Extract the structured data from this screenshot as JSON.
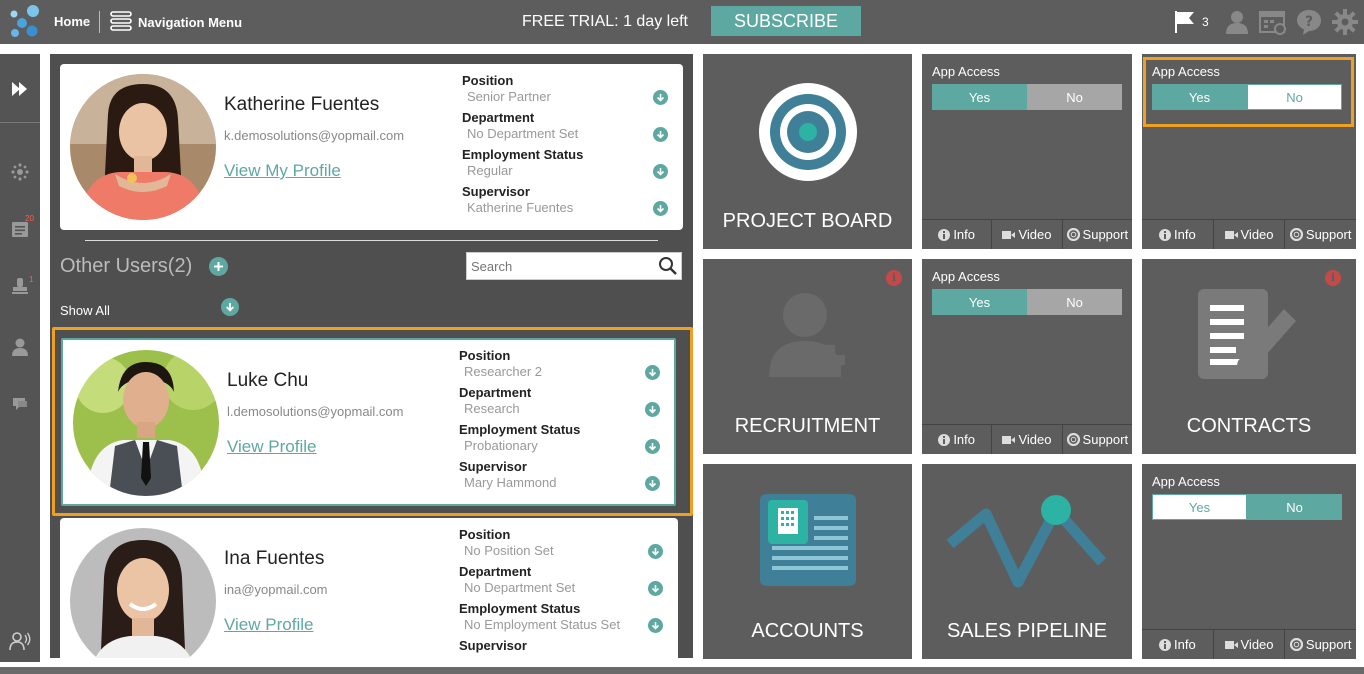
{
  "header": {
    "home": "Home",
    "nav_menu": "Navigation Menu",
    "trial_text": "FREE TRIAL: 1 day left",
    "subscribe": "SUBSCRIBE",
    "flag_count": "3",
    "icons": [
      "flag-icon",
      "user-icon",
      "calendar-settings-icon",
      "help-icon",
      "gear-icon"
    ]
  },
  "rail": {
    "badges": {
      "tasks": "20",
      "approvals": "1"
    },
    "icons": [
      "expand-icon",
      "dashboard-icon",
      "tasks-icon",
      "stamp-icon",
      "user-icon",
      "chat-icon",
      "users-voice-icon"
    ]
  },
  "me": {
    "name": "Katherine Fuentes",
    "email": "k.demosolutions@yopmail.com",
    "link": "View My Profile",
    "fields": [
      {
        "label": "Position",
        "value": "Senior Partner"
      },
      {
        "label": "Department",
        "value": "No Department Set"
      },
      {
        "label": "Employment Status",
        "value": "Regular"
      },
      {
        "label": "Supervisor",
        "value": "Katherine Fuentes"
      }
    ]
  },
  "others": {
    "title": "Other Users(2)",
    "search_placeholder": "Search",
    "show_all": "Show All",
    "users": [
      {
        "name": "Luke Chu",
        "email": "l.demosolutions@yopmail.com",
        "link": "View Profile",
        "fields": [
          {
            "label": "Position",
            "value": "Researcher 2"
          },
          {
            "label": "Department",
            "value": "Research"
          },
          {
            "label": "Employment Status",
            "value": "Probationary"
          },
          {
            "label": "Supervisor",
            "value": "Mary Hammond"
          }
        ]
      },
      {
        "name": "Ina Fuentes",
        "email": "ina@yopmail.com",
        "link": "View Profile",
        "fields": [
          {
            "label": "Position",
            "value": "No Position Set"
          },
          {
            "label": "Department",
            "value": "No Department Set"
          },
          {
            "label": "Employment Status",
            "value": "No Employment Status Set"
          },
          {
            "label": "Supervisor",
            "value": ""
          }
        ]
      }
    ]
  },
  "apps": {
    "project_board": "PROJECT BOARD",
    "recruitment": "RECRUITMENT",
    "contracts": "CONTRACTS",
    "accounts": "ACCOUNTS",
    "sales_pipeline": "SALES PIPELINE",
    "access_label": "App Access",
    "yes": "Yes",
    "no": "No",
    "info": "Info",
    "video": "Video",
    "support": "Support",
    "info_mark": "i"
  },
  "colors": {
    "accent": "#5ea8a2",
    "highlight": "#f0a020",
    "tile": "#5d5d5d"
  }
}
